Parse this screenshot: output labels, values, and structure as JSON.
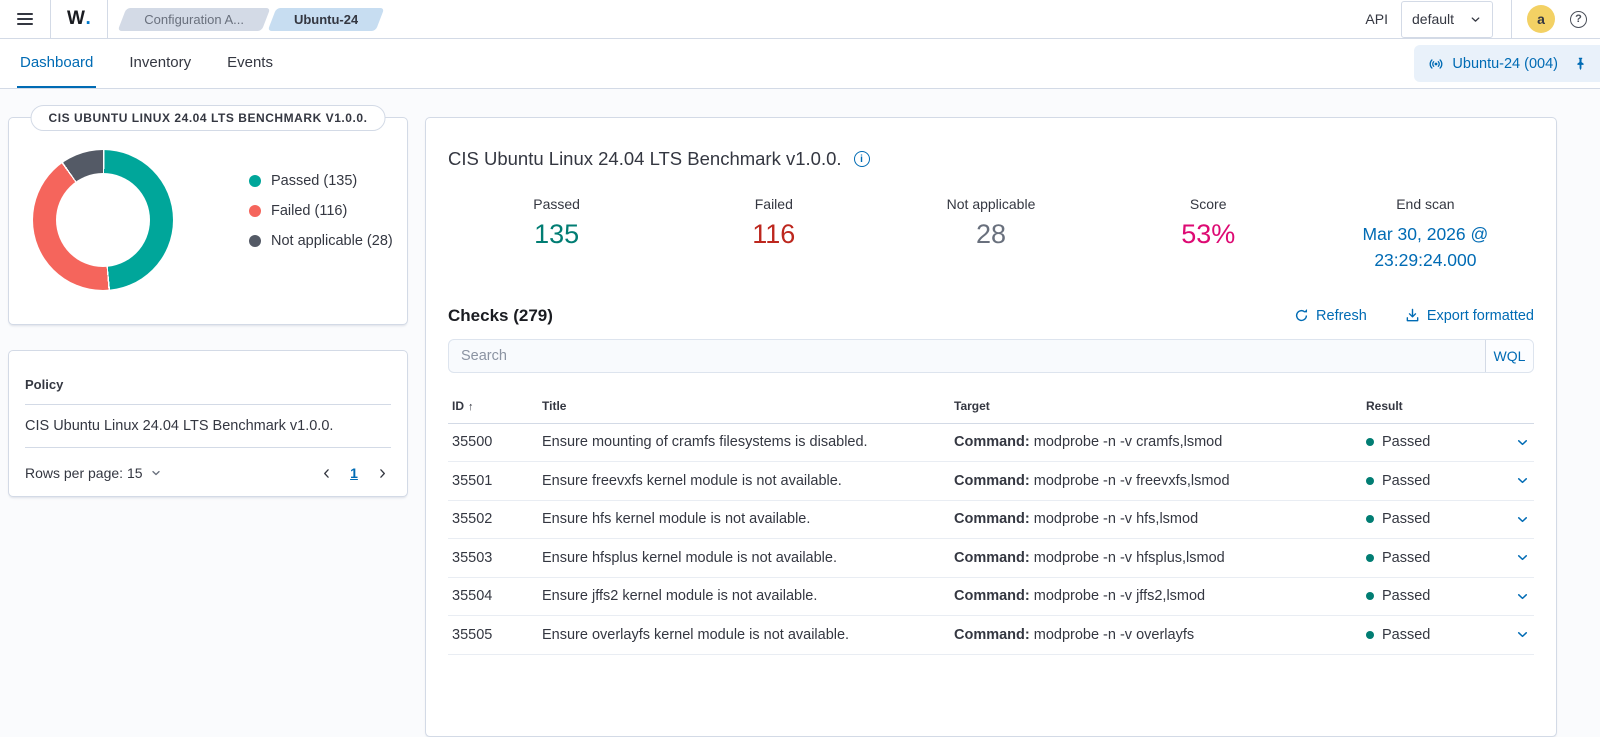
{
  "header": {
    "logo_text": "W",
    "logo_dot": ".",
    "breadcrumbs": [
      {
        "label": "Configuration A...",
        "active": false
      },
      {
        "label": "Ubuntu-24",
        "active": true
      }
    ],
    "api_label": "API",
    "api_host": "default",
    "avatar_initial": "a"
  },
  "icons": {
    "help": "?",
    "info": "i",
    "sort_asc": "↑"
  },
  "tabs": [
    {
      "label": "Dashboard",
      "active": true
    },
    {
      "label": "Inventory",
      "active": false
    },
    {
      "label": "Events",
      "active": false
    }
  ],
  "pinned_agent": {
    "label": "Ubuntu-24 (004)"
  },
  "summary_card": {
    "badge": "CIS UBUNTU LINUX 24.04 LTS BENCHMARK V1.0.0.",
    "legend": [
      {
        "label": "Passed (135)",
        "color": "#00a69a"
      },
      {
        "label": "Failed (116)",
        "color": "#f5655c"
      },
      {
        "label": "Not applicable (28)",
        "color": "#545a66"
      }
    ]
  },
  "chart_data": {
    "type": "pie",
    "donut": true,
    "title": "CIS UBUNTU LINUX 24.04 LTS BENCHMARK V1.0.0.",
    "categories": [
      "Passed",
      "Failed",
      "Not applicable"
    ],
    "values": [
      135,
      116,
      28
    ],
    "colors": [
      "#00a69a",
      "#f5655c",
      "#545a66"
    ],
    "total": 279,
    "legend_position": "right"
  },
  "policy_card": {
    "column_header": "Policy",
    "policy_name": "CIS Ubuntu Linux 24.04 LTS Benchmark v1.0.0.",
    "rows_per_page": "Rows per page: 15",
    "page_number": "1"
  },
  "main": {
    "title": "CIS Ubuntu Linux 24.04 LTS Benchmark v1.0.0.",
    "stats": [
      {
        "label": "Passed",
        "value": "135",
        "color": "#017d73"
      },
      {
        "label": "Failed",
        "value": "116",
        "color": "#bd271e"
      },
      {
        "label": "Not applicable",
        "value": "28",
        "color": "#69707d"
      },
      {
        "label": "Score",
        "value": "53%",
        "color": "#dd0a73"
      },
      {
        "label": "End scan",
        "value": "Mar 30, 2026 @ 23:29:24.000",
        "color": "#006bb4"
      }
    ],
    "checks_heading": "Checks (279)",
    "actions": {
      "refresh": "Refresh",
      "export": "Export formatted"
    },
    "search": {
      "placeholder": "Search",
      "wql": "WQL"
    },
    "table": {
      "headers": {
        "id": "ID",
        "title": "Title",
        "target": "Target",
        "result": "Result"
      },
      "rows": [
        {
          "id": "35500",
          "title": "Ensure mounting of cramfs filesystems is disabled.",
          "target_label": "Command:",
          "target": "modprobe -n -v cramfs,lsmod",
          "result": "Passed"
        },
        {
          "id": "35501",
          "title": "Ensure freevxfs kernel module is not available.",
          "target_label": "Command:",
          "target": "modprobe -n -v freevxfs,lsmod",
          "result": "Passed"
        },
        {
          "id": "35502",
          "title": "Ensure hfs kernel module is not available.",
          "target_label": "Command:",
          "target": "modprobe -n -v hfs,lsmod",
          "result": "Passed"
        },
        {
          "id": "35503",
          "title": "Ensure hfsplus kernel module is not available.",
          "target_label": "Command:",
          "target": "modprobe -n -v hfsplus,lsmod",
          "result": "Passed"
        },
        {
          "id": "35504",
          "title": "Ensure jffs2 kernel module is not available.",
          "target_label": "Command:",
          "target": "modprobe -n -v jffs2,lsmod",
          "result": "Passed"
        },
        {
          "id": "35505",
          "title": "Ensure overlayfs kernel module is not available.",
          "target_label": "Command:",
          "target": "modprobe -n -v overlayfs",
          "result": "Passed"
        }
      ]
    }
  }
}
